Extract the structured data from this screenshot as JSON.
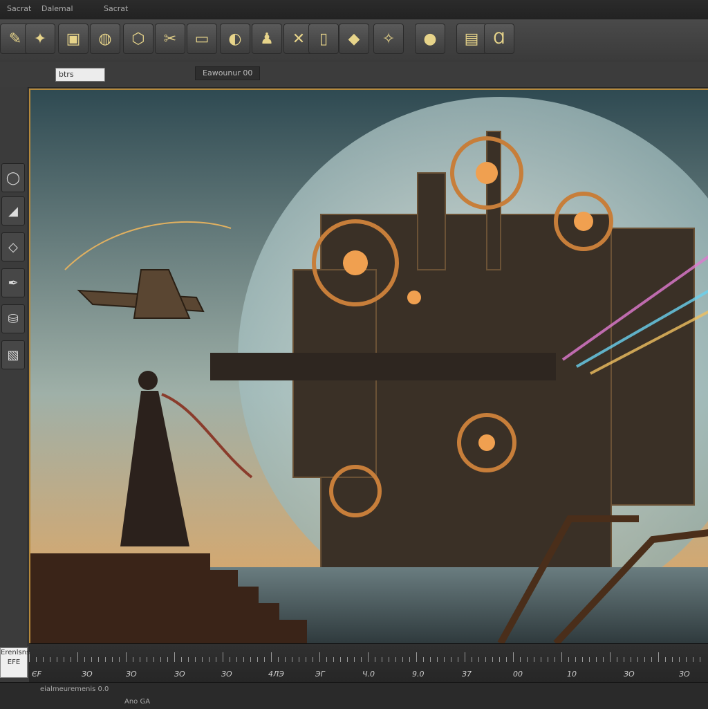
{
  "topbar": {
    "menu_a": "Sacrat",
    "menu_b": "Dalemal",
    "menu_c": "Sacrat"
  },
  "ribbon": {
    "tools": [
      "pen-tool-icon",
      "brush-icon",
      "layer-icon",
      "color-icon",
      "shape-icon",
      "cut-icon",
      "frame-icon",
      "mask-icon",
      "figure-icon",
      "select-icon",
      "cross-icon",
      "file-icon",
      "tag-icon",
      "transform-icon",
      "record-icon",
      "stamp-icon",
      "font-icon"
    ]
  },
  "subbar": {
    "field_value": "btrs",
    "path_label": "Eawounur 00"
  },
  "sidebar": {
    "label": "~"
  },
  "ruler": {
    "labels": [
      "ЄF",
      "ЗО",
      "ЗО",
      "ЗО",
      "ЗО",
      "4ЛЭ",
      "ЭГ",
      "Ч.0",
      "9.0",
      "З7",
      "00",
      "10",
      "ЗО",
      "ЗО"
    ]
  },
  "leftbox": {
    "line1": "Erenlsns",
    "line2": "EFE"
  },
  "status": {
    "text": "eialmeuremenis 0.0",
    "mini": "Ano GA"
  },
  "colors": {
    "accent": "#b68a3c",
    "panel": "#3b3b3b",
    "canvas_sky_top": "#2f4a52",
    "canvas_sky_bottom": "#e9a55a"
  }
}
